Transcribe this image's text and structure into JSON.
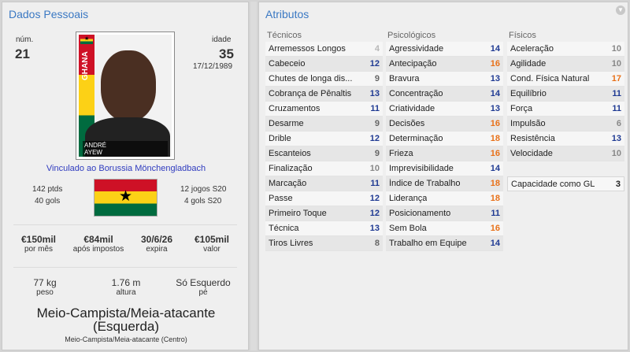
{
  "left": {
    "title": "Dados Pessoais",
    "number_label": "núm.",
    "number": "21",
    "age_label": "idade",
    "age": "35",
    "birthdate": "17/12/1989",
    "photo_flag_text": "GHANA",
    "photo_name_line1": "ANDRÉ",
    "photo_name_line2": "AYEW",
    "club": "Vinculado ao Borussia Mönchengladbach",
    "caps": "142 ptds",
    "goals": "40 gols",
    "u20_caps": "12 jogos S20",
    "u20_goals": "4 gols S20",
    "finance": [
      {
        "value": "€150mil",
        "label": "por mês"
      },
      {
        "value": "€84mil",
        "label": "após impostos"
      },
      {
        "value": "30/6/26",
        "label": "expira"
      },
      {
        "value": "€105mil",
        "label": "valor"
      }
    ],
    "physical": [
      {
        "value": "77 kg",
        "label": "peso"
      },
      {
        "value": "1.76 m",
        "label": "altura"
      },
      {
        "value": "Só Esquerdo",
        "label": "pé"
      }
    ],
    "position_line1": "Meio-Campista/Meia-atacante",
    "position_line2": "(Esquerda)",
    "position_secondary": "Meio-Campista/Meia-atacante (Centro)"
  },
  "right": {
    "title": "Atributos",
    "collapse_icon": "chevron-down-icon",
    "columns": [
      {
        "header": "Técnicos",
        "rows": [
          {
            "name": "Arremessos Longos",
            "value": "4",
            "color": "#b8b8b8"
          },
          {
            "name": "Cabeceio",
            "value": "12",
            "color": "#1f3a93"
          },
          {
            "name": "Chutes de longa dis...",
            "value": "9",
            "color": "#666666"
          },
          {
            "name": "Cobrança de Pênaltis",
            "value": "13",
            "color": "#1f3a93"
          },
          {
            "name": "Cruzamentos",
            "value": "11",
            "color": "#1f3a93"
          },
          {
            "name": "Desarme",
            "value": "9",
            "color": "#666666"
          },
          {
            "name": "Drible",
            "value": "12",
            "color": "#1f3a93"
          },
          {
            "name": "Escanteios",
            "value": "9",
            "color": "#666666"
          },
          {
            "name": "Finalização",
            "value": "10",
            "color": "#888888"
          },
          {
            "name": "Marcação",
            "value": "11",
            "color": "#1f3a93"
          },
          {
            "name": "Passe",
            "value": "12",
            "color": "#1f3a93"
          },
          {
            "name": "Primeiro Toque",
            "value": "12",
            "color": "#1f3a93"
          },
          {
            "name": "Técnica",
            "value": "13",
            "color": "#1f3a93"
          },
          {
            "name": "Tiros Livres",
            "value": "8",
            "color": "#666666"
          }
        ]
      },
      {
        "header": "Psicológicos",
        "rows": [
          {
            "name": "Agressividade",
            "value": "14",
            "color": "#1f3a93"
          },
          {
            "name": "Antecipação",
            "value": "16",
            "color": "#e8711a"
          },
          {
            "name": "Bravura",
            "value": "13",
            "color": "#1f3a93"
          },
          {
            "name": "Concentração",
            "value": "14",
            "color": "#1f3a93"
          },
          {
            "name": "Criatividade",
            "value": "13",
            "color": "#1f3a93"
          },
          {
            "name": "Decisões",
            "value": "16",
            "color": "#e8711a"
          },
          {
            "name": "Determinação",
            "value": "18",
            "color": "#e8711a"
          },
          {
            "name": "Frieza",
            "value": "16",
            "color": "#e8711a"
          },
          {
            "name": "Imprevisibilidade",
            "value": "14",
            "color": "#1f3a93"
          },
          {
            "name": "Índice de Trabalho",
            "value": "18",
            "color": "#e8711a"
          },
          {
            "name": "Liderança",
            "value": "18",
            "color": "#e8711a"
          },
          {
            "name": "Posicionamento",
            "value": "11",
            "color": "#1f3a93"
          },
          {
            "name": "Sem Bola",
            "value": "16",
            "color": "#e8711a"
          },
          {
            "name": "Trabalho em Equipe",
            "value": "14",
            "color": "#1f3a93"
          }
        ]
      },
      {
        "header": "Físicos",
        "rows": [
          {
            "name": "Aceleração",
            "value": "10",
            "color": "#888888"
          },
          {
            "name": "Agilidade",
            "value": "10",
            "color": "#888888"
          },
          {
            "name": "Cond. Física Natural",
            "value": "17",
            "color": "#e8711a"
          },
          {
            "name": "Equilíbrio",
            "value": "11",
            "color": "#1f3a93"
          },
          {
            "name": "Força",
            "value": "11",
            "color": "#1f3a93"
          },
          {
            "name": "Impulsão",
            "value": "6",
            "color": "#888888"
          },
          {
            "name": "Resistência",
            "value": "13",
            "color": "#1f3a93"
          },
          {
            "name": "Velocidade",
            "value": "10",
            "color": "#888888"
          }
        ],
        "extra": {
          "name": "Capacidade como GL",
          "value": "3"
        }
      }
    ]
  }
}
